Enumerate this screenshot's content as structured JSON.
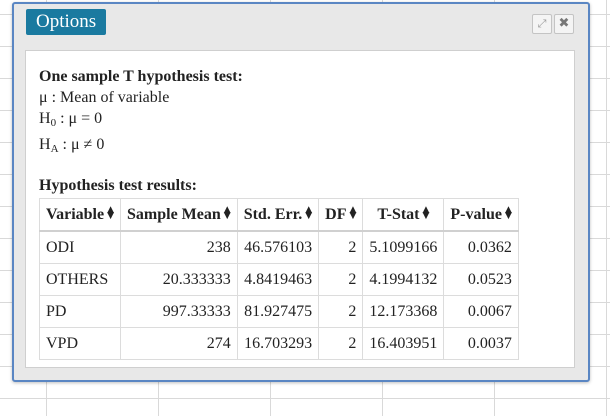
{
  "window": {
    "title": "Options",
    "expand_icon": "expand-icon",
    "close_icon": "close-icon"
  },
  "test": {
    "heading": "One sample T hypothesis test:",
    "mu_line": "μ : Mean of variable",
    "h0_main": "H",
    "h0_sub": "0",
    "h0_rest": " : μ = 0",
    "ha_main": "H",
    "ha_sub": "A",
    "ha_rest": " : μ ≠ 0"
  },
  "results": {
    "heading": "Hypothesis test results:",
    "columns": [
      "Variable",
      "Sample Mean",
      "Std. Err.",
      "DF",
      "T-Stat",
      "P-value"
    ],
    "rows": [
      [
        "ODI",
        "238",
        "46.576103",
        "2",
        "5.1099166",
        "0.0362"
      ],
      [
        "OTHERS",
        "20.333333",
        "4.8419463",
        "2",
        "4.1994132",
        "0.0523"
      ],
      [
        "PD",
        "997.33333",
        "81.927475",
        "2",
        "12.173368",
        "0.0067"
      ],
      [
        "VPD",
        "274",
        "16.703293",
        "2",
        "16.403951",
        "0.0037"
      ]
    ]
  }
}
